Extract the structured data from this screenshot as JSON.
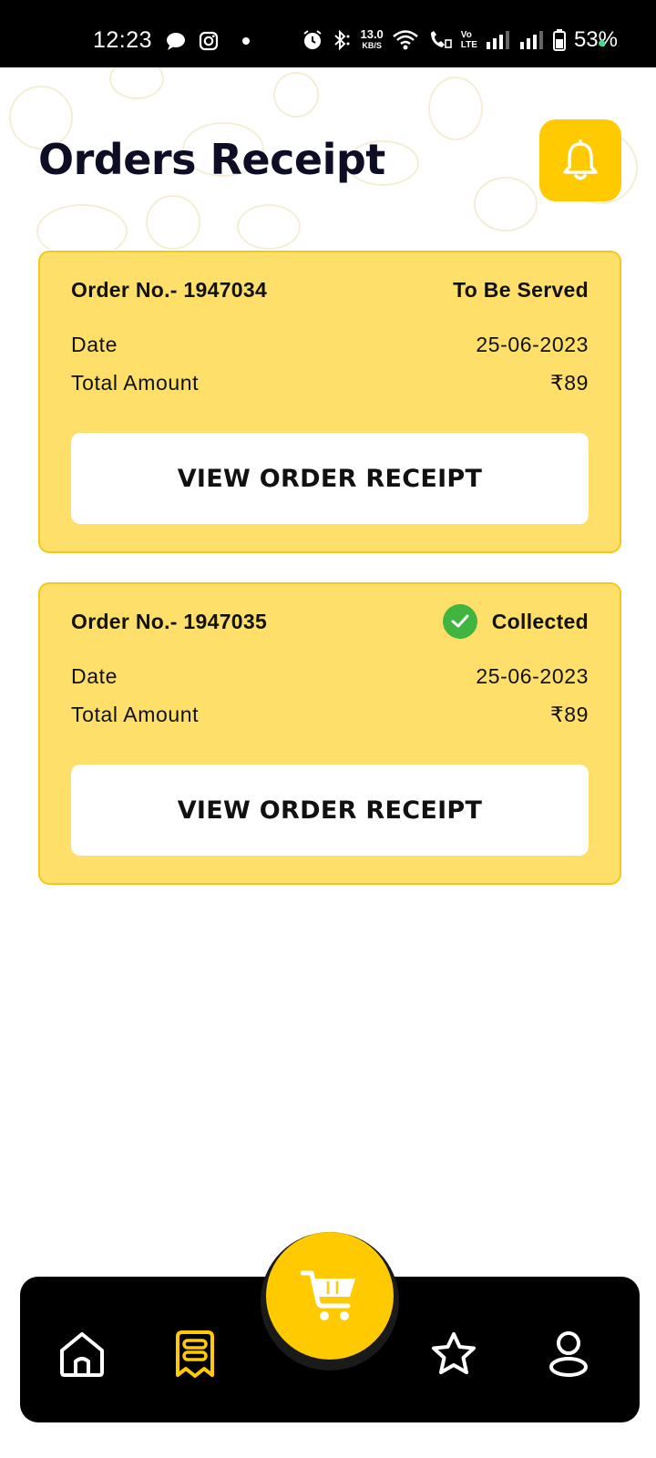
{
  "status_bar": {
    "time": "12:23",
    "speed_value": "13.0",
    "speed_unit": "KB/S",
    "volte_top": "Vo",
    "volte_bottom": "LTE",
    "battery": "53%"
  },
  "header": {
    "title": "Orders Receipt",
    "notification_icon": "bell-icon"
  },
  "orders": [
    {
      "order_no": "Order No.- 1947034",
      "status": "To Be Served",
      "date_label": "Date",
      "date_value": "25-06-2023",
      "amount_label": "Total Amount",
      "amount_value": "₹89",
      "button_label": "VIEW ORDER RECEIPT"
    },
    {
      "order_no": "Order No.- 1947035",
      "status": "Collected",
      "status_icon": "check-circle-icon",
      "date_label": "Date",
      "date_value": "25-06-2023",
      "amount_label": "Total Amount",
      "amount_value": "₹89",
      "button_label": "VIEW ORDER RECEIPT"
    }
  ],
  "bottom_nav": {
    "items": [
      "home-icon",
      "receipt-icon",
      "cart-icon",
      "star-icon",
      "profile-icon"
    ],
    "active": "receipt-icon"
  },
  "colors": {
    "accent": "#ffcb00",
    "card_bg": "#fddf6a",
    "title": "#0d0d26",
    "success": "#3fb43f",
    "nav_bg": "#000000"
  }
}
